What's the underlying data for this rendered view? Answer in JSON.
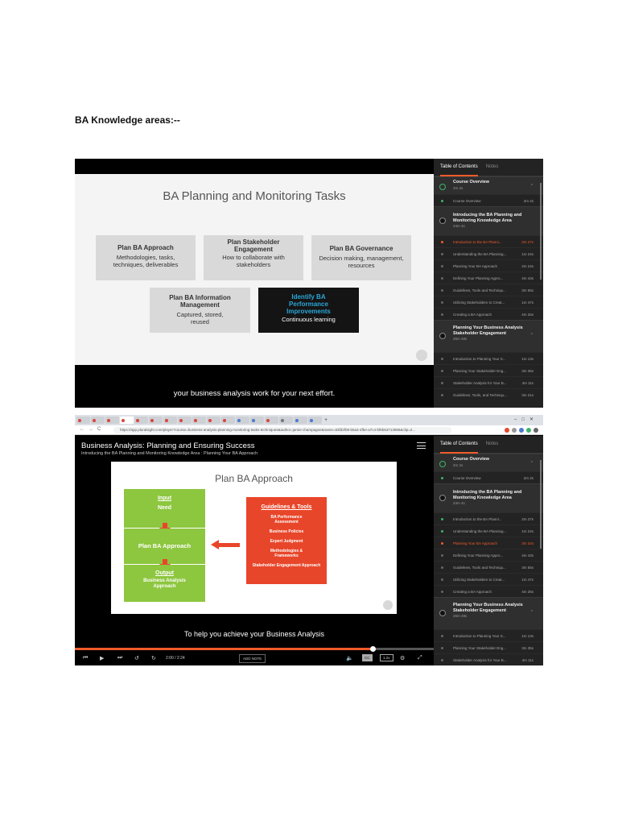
{
  "doc": {
    "heading": "BA Knowledge areas:--"
  },
  "shot1": {
    "slide_title": "BA Planning and Monitoring Tasks",
    "boxes": [
      {
        "title": "Plan BA Approach",
        "desc": "Methodologies, tasks, techniques, deliverables"
      },
      {
        "title": "Plan Stakeholder Engagement",
        "desc": "How to collaborate with stakeholders"
      },
      {
        "title": "Plan BA Governance",
        "desc": "Decision making, management, resources"
      },
      {
        "title": "Plan BA Information Management",
        "desc": "Captured, stored, reused"
      },
      {
        "title": "Identify BA Performance Improvements",
        "desc": "Continuous learning"
      }
    ],
    "caption": "your business analysis work for your next effort."
  },
  "toc1": {
    "tabs": [
      "Table of Contents",
      "Notes"
    ],
    "modules": [
      {
        "title": "Course Overview",
        "duration": "2m 2s"
      },
      {
        "title": "Introducing the BA Planning and Monitoring Knowledge Area",
        "duration": "24m 4s"
      },
      {
        "title": "Planning Your Business Analysis Stakeholder Engagement",
        "duration": "26m 49s"
      }
    ],
    "clips_overview": [
      {
        "name": "Course Overview",
        "time": "2m 2s"
      }
    ],
    "clips_intro": [
      {
        "name": "Introduction to the BA Planni...",
        "time": "2m 27s"
      },
      {
        "name": "Understanding the BA Planning...",
        "time": "1m 24s"
      },
      {
        "name": "Planning Your BA Approach",
        "time": "2m 24s"
      },
      {
        "name": "Defining Your Planning Appro...",
        "time": "4m 43s"
      },
      {
        "name": "Guidelines, Tools and Techniqu...",
        "time": "3m 55s"
      },
      {
        "name": "Utilizing Stakeholders to Creat...",
        "time": "1m 47s"
      },
      {
        "name": "Creating a BA Approach",
        "time": "4m 26s"
      }
    ],
    "clips_stakeholder": [
      {
        "name": "Introduction to Planning Your S...",
        "time": "1m 13s"
      },
      {
        "name": "Planning Your Stakeholder Eng...",
        "time": "3m 35s"
      },
      {
        "name": "Stakeholder Analysis for Your B...",
        "time": "4m 11s"
      },
      {
        "name": "Guidelines, Tools, and Techniqu...",
        "time": "3m 21s"
      }
    ]
  },
  "shot2": {
    "browser": {
      "tabs": [
        "Hypo",
        "Payn",
        "Busin",
        "Bu",
        "Interv",
        "Busin",
        "Busin",
        "Busin",
        "Busin",
        "Busin",
        "Busin",
        "Dece",
        "BCBS",
        "Busin",
        "onlin",
        "Beep",
        "Searc"
      ],
      "url": "https://app.pluralsight.com/player?course=business-analysis-planning-monitoring-tasks-techniques&author=jamie-champagne&name=83fd2f08-b5a3-4fbe-a7c4-bf6b53713986&clip=2..."
    },
    "player": {
      "title": "Business Analysis: Planning and Ensuring Success",
      "subtitle": "Introducing the BA Planning and Monitoring Knowledge Area : Planning Your BA Approach",
      "slide_title": "Plan BA Approach",
      "input_label": "Input",
      "need": "Need",
      "plan": "Plan BA Approach",
      "output_label": "Output",
      "output_value": "Business Analysis Approach",
      "guidelines_title": "Guidelines & Tools",
      "guidelines": [
        "BA Performance Assessment",
        "Business Policies",
        "Expert Judgment",
        "Methodologies & Frameworks",
        "Stakeholder Engagement Approach"
      ],
      "caption": "To help you achieve your Business Analysis",
      "time": "2:00 / 2:24",
      "progress": 0.83,
      "add_note": "ADD NOTE",
      "cc": "CC",
      "speed": "1.2x"
    }
  },
  "toc2": {
    "tabs": [
      "Table of Contents",
      "Notes"
    ],
    "modules": [
      {
        "title": "Course Overview",
        "duration": "2m 2s"
      },
      {
        "title": "Introducing the BA Planning and Monitoring Knowledge Area",
        "duration": "24m 4s"
      },
      {
        "title": "Planning Your Business Analysis Stakeholder Engagement",
        "duration": "26m 49s"
      }
    ],
    "clips_overview": [
      {
        "name": "Course Overview",
        "time": "2m 2s"
      }
    ],
    "clips_intro": [
      {
        "name": "Introduction to the BA Planni...",
        "time": "2m 27s"
      },
      {
        "name": "Understanding the BA Planning...",
        "time": "1m 24s"
      },
      {
        "name": "Planning Your BA Approach",
        "time": "3m 34s"
      },
      {
        "name": "Defining Your Planning Appro...",
        "time": "4m 43s"
      },
      {
        "name": "Guidelines, Tools and Techniqu...",
        "time": "3m 55s"
      },
      {
        "name": "Utilizing Stakeholders to Creat...",
        "time": "1m 47s"
      },
      {
        "name": "Creating a BA Approach",
        "time": "4m 26s"
      }
    ],
    "clips_stakeholder": [
      {
        "name": "Introduction to Planning Your S...",
        "time": "1m 13s"
      },
      {
        "name": "Planning Your Stakeholder Eng...",
        "time": "3m 35s"
      },
      {
        "name": "Stakeholder Analysis for Your B...",
        "time": "4m 11s"
      }
    ]
  },
  "colors": {
    "accent": "#f15b2a",
    "green": "#8dc63f",
    "red": "#e8462a",
    "blue": "#2aa7d8",
    "done": "#3db36b"
  }
}
